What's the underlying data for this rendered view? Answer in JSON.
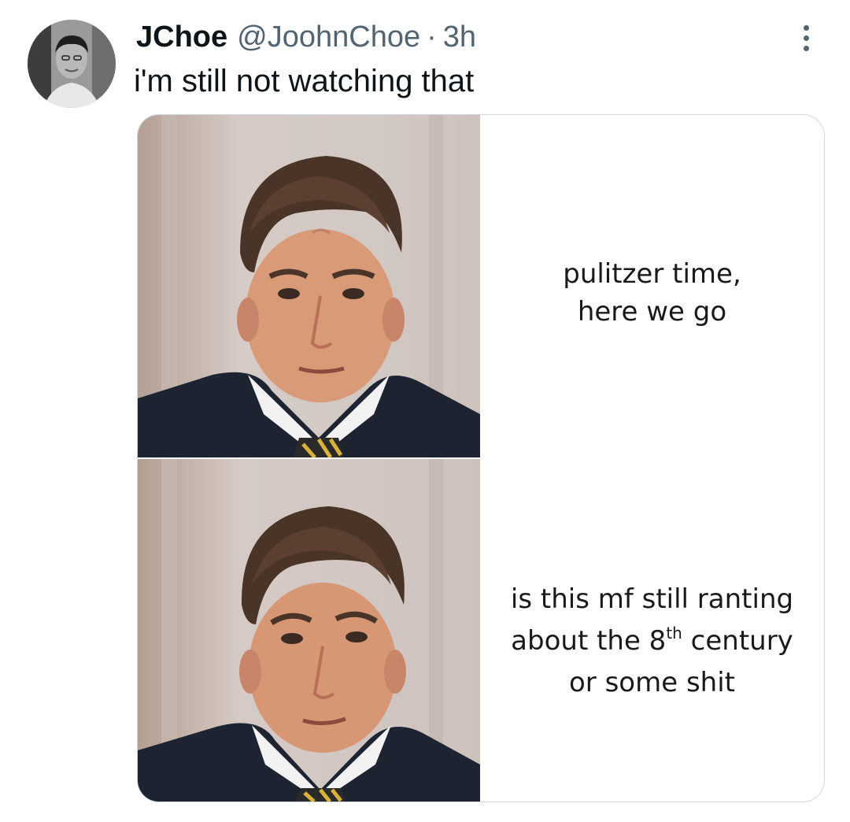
{
  "tweet": {
    "display_name": "JChoe",
    "handle": "@JoohnChoe",
    "separator": "·",
    "time": "3h",
    "text": "i'm still not watching that"
  },
  "meme": {
    "top_caption": {
      "line1": "pulitzer time,",
      "line2": "here we go"
    },
    "bottom_caption": {
      "line1": "is this mf still ranting",
      "line2_before": "about the 8",
      "line2_sup": "th",
      "line2_after": " century",
      "line3": "or some shit"
    }
  },
  "colors": {
    "text_primary": "#0f1419",
    "text_secondary": "#536471",
    "card_border": "#cfd9de"
  }
}
